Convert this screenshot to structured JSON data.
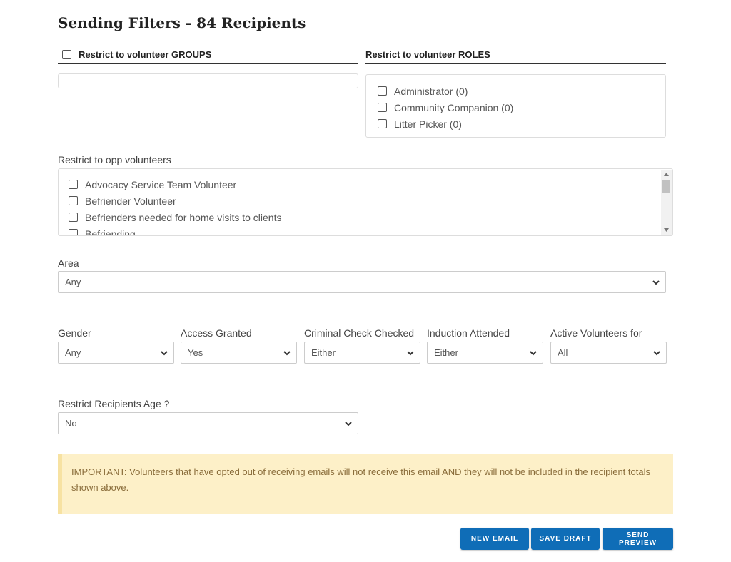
{
  "page": {
    "title": "Sending Filters - 84 Recipients"
  },
  "groups": {
    "label": "Restrict to volunteer GROUPS",
    "checked": false,
    "input_value": ""
  },
  "roles": {
    "label": "Restrict to volunteer ROLES",
    "items": [
      {
        "label": "Administrator (0)",
        "checked": false
      },
      {
        "label": "Community Companion (0)",
        "checked": false
      },
      {
        "label": "Litter Picker (0)",
        "checked": false
      }
    ]
  },
  "opps": {
    "label": "Restrict to opp volunteers",
    "items": [
      {
        "label": "Advocacy Service Team Volunteer",
        "checked": false
      },
      {
        "label": "Befriender Volunteer",
        "checked": false
      },
      {
        "label": "Befrienders needed for home visits to clients",
        "checked": false
      },
      {
        "label": "Befriending",
        "checked": false
      }
    ]
  },
  "area": {
    "label": "Area",
    "value": "Any"
  },
  "filters": {
    "gender": {
      "label": "Gender",
      "value": "Any"
    },
    "access": {
      "label": "Access Granted",
      "value": "Yes"
    },
    "criminal": {
      "label": "Criminal Check Checked",
      "value": "Either"
    },
    "induction": {
      "label": "Induction Attended",
      "value": "Either"
    },
    "active": {
      "label": "Active Volunteers for",
      "value": "All"
    }
  },
  "age": {
    "label": "Restrict Recipients Age ?",
    "value": "No"
  },
  "notice": {
    "text": "IMPORTANT: Volunteers that have opted out of receiving emails will not receive this email AND they will not be included in the recipient totals shown above."
  },
  "buttons": {
    "new_email": "NEW EMAIL",
    "save_draft": "SAVE DRAFT",
    "send_preview": "SEND PREVIEW"
  },
  "colors": {
    "button": "#0f6db7",
    "notice_bg": "#fdf0c8",
    "notice_text": "#8a6d3b"
  },
  "icons": {
    "select_arrow": "chevron-down-icon",
    "scroll_up": "scroll-up-icon",
    "scroll_down": "scroll-down-icon"
  }
}
